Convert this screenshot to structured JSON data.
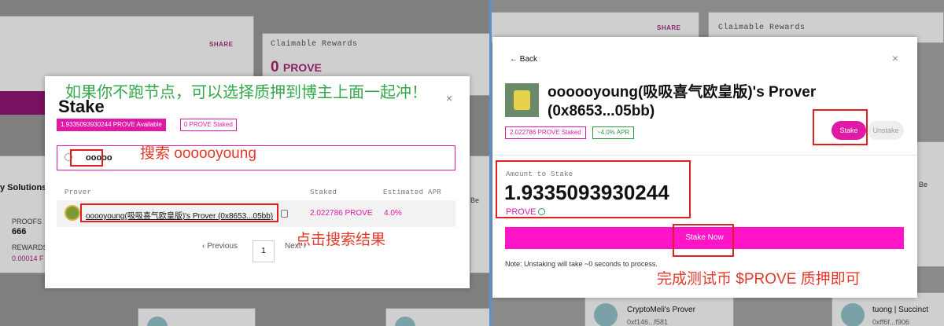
{
  "left_panel": {
    "background": {
      "share_label": "SHARE",
      "claimable_label": "Claimable Rewards",
      "claimable_amount": "0",
      "claimable_unit": "PROVE",
      "solutions_text": "y Solutions",
      "proofs_label": "PROOFS",
      "proofs_value": "666",
      "rewards_label": "REWARDS",
      "rewards_value": "0.00014 F",
      "right_edge_text": "Be"
    },
    "modal": {
      "title": "Stake",
      "close_glyph": "×",
      "available_tag": "1.9335093930244 PROVE Available",
      "staked_tag": "0 PROVE Staked",
      "search_value": "ooooo",
      "table_headers": {
        "prover": "Prover",
        "staked": "Staked",
        "apr": "Estimated APR"
      },
      "row": {
        "name": "ooooyoung(吸吸喜气欧皇版)'s Prover (0x8653...05bb)",
        "staked": "2.022786 PROVE",
        "apr": "4.0%"
      },
      "pagination": {
        "previous": "‹ Previous",
        "page": "1",
        "next": "Next ›"
      }
    },
    "annotations": {
      "green_tip": "如果你不跑节点，可以选择质押到博主上面一起冲！",
      "search_tip": "搜索 oooooyoung",
      "click_tip": "点击搜索结果"
    }
  },
  "right_panel": {
    "background": {
      "share_label": "SHARE",
      "claimable_label": "Claimable Rewards",
      "right_edge_text": "Be",
      "card1_name": "CryptoMeli's Prover",
      "card1_addr": "0xf146...f581",
      "card2_name": "tuong | Succinct",
      "card2_addr": "0xff6f...f906"
    },
    "modal": {
      "back_label": "← Back",
      "close_glyph": "×",
      "prover_name": "oooooyoung(吸吸喜气欧皇版)'s Prover (0x8653...05bb)",
      "staked_tag": "2.022786 PROVE Staked",
      "apr_tag": "~4.0% APR",
      "stake_tab": "Stake",
      "unstake_tab": "Unstake",
      "amount_label": "Amount to Stake",
      "amount_value": "1.9335093930244",
      "amount_unit": "PROVE",
      "stake_now": "Stake Now",
      "note": "Note: Unstaking will take ~0 seconds to process."
    },
    "annotations": {
      "done_tip": "完成测试币 $PROVE 质押即可"
    }
  },
  "colors": {
    "accent": "#e01aa6",
    "annotation_red": "#e23a2a",
    "annotation_green": "#33a84a",
    "apr_green": "#2a9a4a"
  }
}
